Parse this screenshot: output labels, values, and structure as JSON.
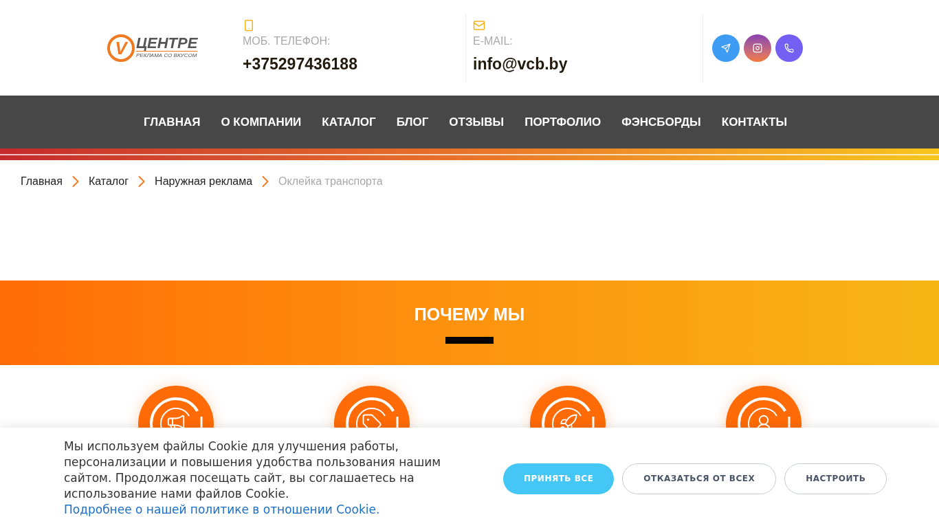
{
  "logo": {
    "mark": "V",
    "name": "ЦЕНТРЕ",
    "tagline": "РЕКЛАМА СО ВКУСОМ"
  },
  "contacts": [
    {
      "kind": "phone",
      "label": "МОБ. ТЕЛЕФОН:",
      "value": "+375297436188"
    },
    {
      "kind": "email",
      "label": "E-MAIL:",
      "value": "info@vcb.by"
    }
  ],
  "socials": [
    {
      "kind": "telegram"
    },
    {
      "kind": "instagram"
    },
    {
      "kind": "viber"
    }
  ],
  "nav": [
    "ГЛАВНАЯ",
    "О КОМПАНИИ",
    "КАТАЛОГ",
    "БЛОГ",
    "ОТЗЫВЫ",
    "ПОРТФОЛИО",
    "ФЭНСБОРДЫ",
    "КОНТАКТЫ"
  ],
  "breadcrumbs": [
    {
      "label": "Главная",
      "current": false
    },
    {
      "label": "Каталог",
      "current": false
    },
    {
      "label": "Наружная реклама",
      "current": false
    },
    {
      "label": "Оклейка транспорта",
      "current": true
    }
  ],
  "why_us": {
    "title": "ПОЧЕМУ МЫ",
    "features": [
      {
        "kind": "megaphone"
      },
      {
        "kind": "tag"
      },
      {
        "kind": "rocket"
      },
      {
        "kind": "person"
      }
    ]
  },
  "cookie_banner": {
    "text": "Мы используем файлы Cookie для улучшения работы, персонализации и повышения удобства пользования нашим сайтом. Продолжая посещать сайт, вы соглашаетесь на использование нами файлов Cookie.",
    "link": "Подробнее о нашей политике в отношении Cookie.",
    "buttons": [
      {
        "label": "ПРИНЯТЬ ВСЕ",
        "kind": "primary"
      },
      {
        "label": "ОТКАЗАТЬСЯ ОТ ВСЕХ",
        "kind": "outline"
      },
      {
        "label": "НАСТРОИТЬ",
        "kind": "outline"
      }
    ]
  }
}
